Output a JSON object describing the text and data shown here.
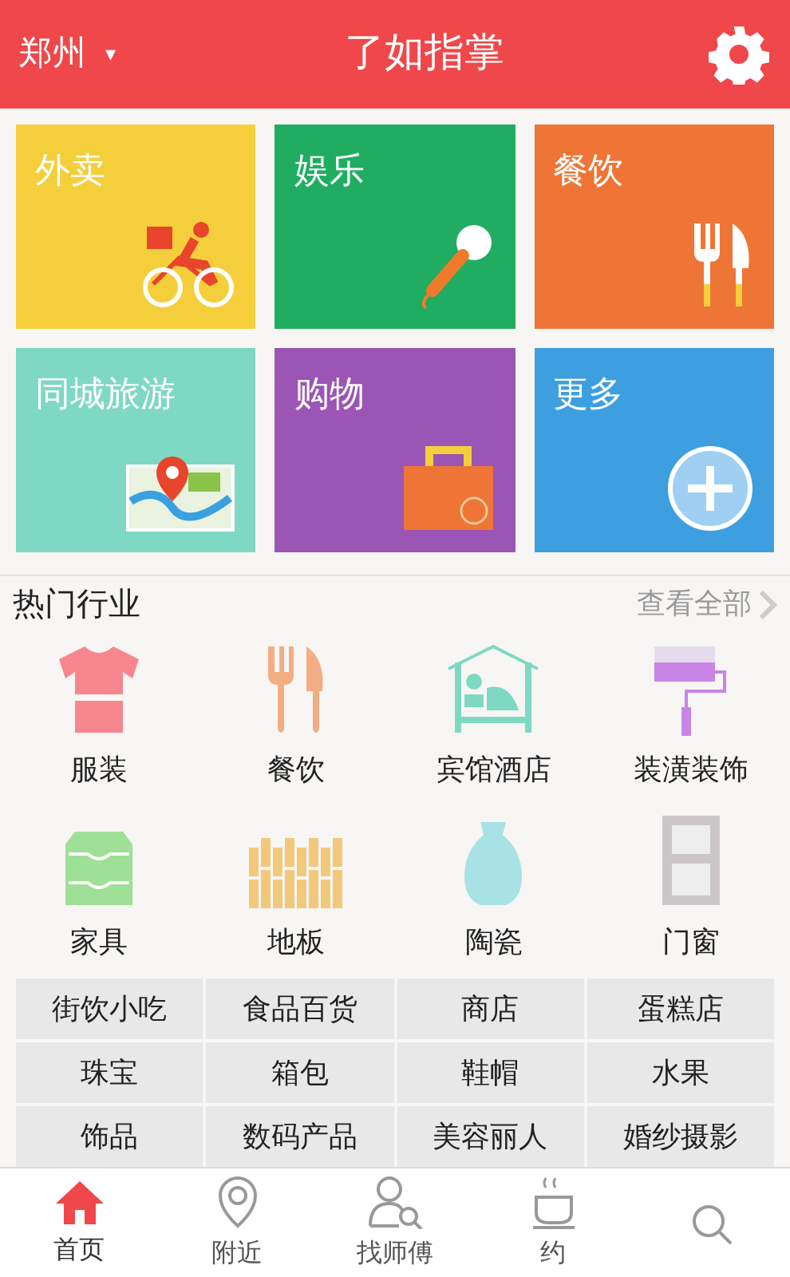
{
  "header": {
    "city": "郑州",
    "dropdown": "▾",
    "title": "了如指掌"
  },
  "tiles": [
    {
      "label": "外卖",
      "color": "#f4cf3b"
    },
    {
      "label": "娱乐",
      "color": "#20ad62"
    },
    {
      "label": "餐饮",
      "color": "#ee7535"
    },
    {
      "label": "同城旅游",
      "color": "#7fd8c3"
    },
    {
      "label": "购物",
      "color": "#9b55b5"
    },
    {
      "label": "更多",
      "color": "#3d9fe0"
    }
  ],
  "hot_section": {
    "title": "热门行业",
    "view_all": "查看全部"
  },
  "industries": [
    {
      "label": "服装"
    },
    {
      "label": "餐饮"
    },
    {
      "label": "宾馆酒店"
    },
    {
      "label": "装潢装饰"
    },
    {
      "label": "家具"
    },
    {
      "label": "地板"
    },
    {
      "label": "陶瓷"
    },
    {
      "label": "门窗"
    }
  ],
  "categories": [
    "街饮小吃",
    "食品百货",
    "商店",
    "蛋糕店",
    "珠宝",
    "箱包",
    "鞋帽",
    "水果",
    "饰品",
    "数码产品",
    "美容丽人",
    "婚纱摄影"
  ],
  "bottom_nav": [
    {
      "label": "首页",
      "selected": true
    },
    {
      "label": "附近",
      "selected": false
    },
    {
      "label": "找师傅",
      "selected": false
    },
    {
      "label": "约",
      "selected": false
    },
    {
      "selected": false
    }
  ]
}
